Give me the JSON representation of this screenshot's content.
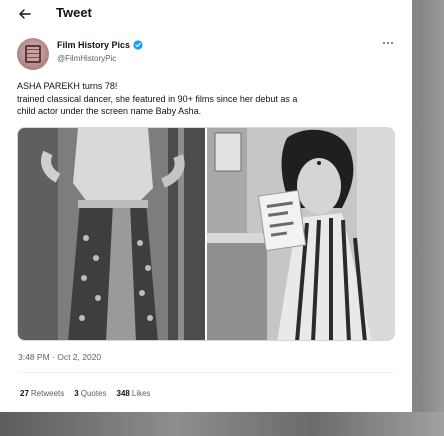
{
  "header": {
    "back_icon": "arrow-left-icon",
    "title": "Tweet"
  },
  "author": {
    "name": "Film History Pics",
    "handle": "@FilmHistoryPic",
    "verified_icon": "verified-badge-icon",
    "avatar_icon": "film-strip-icon"
  },
  "more_icon": "more-horizontal-icon",
  "tweet": {
    "lines": [
      "ASHA PAREKH turns 78!",
      "trained classical dancer, she featured in 90+ films since her debut as a",
      "child actor under the screen name Baby Asha."
    ]
  },
  "timestamp": "3:48 PM · Oct 2, 2020",
  "stats": [
    {
      "count": "27",
      "label": "Retweets"
    },
    {
      "count": "3",
      "label": "Quotes"
    },
    {
      "count": "348",
      "label": "Likes"
    }
  ],
  "colors": {
    "text": "#0f1419",
    "secondary": "#536471",
    "verified": "#1d9bf0",
    "overlay": "#7d7d7d"
  }
}
